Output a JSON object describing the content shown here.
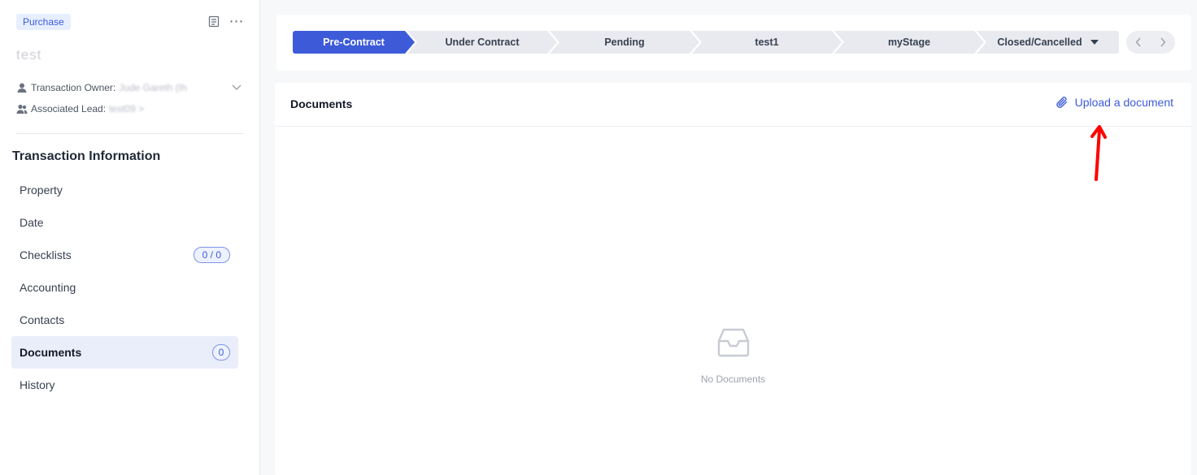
{
  "sidebar": {
    "type_badge": "Purchase",
    "transaction_name": "test",
    "owner_label": "Transaction Owner:",
    "owner_value": "Jude Gareth (Ih",
    "lead_label": "Associated Lead:",
    "lead_value": "test09 >",
    "section_title": "Transaction Information",
    "items": [
      {
        "label": "Property",
        "badge": ""
      },
      {
        "label": "Date",
        "badge": ""
      },
      {
        "label": "Checklists",
        "badge": "0 / 0"
      },
      {
        "label": "Accounting",
        "badge": ""
      },
      {
        "label": "Contacts",
        "badge": ""
      },
      {
        "label": "Documents",
        "badge": "0"
      },
      {
        "label": "History",
        "badge": ""
      }
    ],
    "active_item": "Documents"
  },
  "stages": {
    "items": [
      "Pre-Contract",
      "Under Contract",
      "Pending",
      "test1",
      "myStage",
      "Closed/Cancelled"
    ],
    "active": "Pre-Contract"
  },
  "documents": {
    "title": "Documents",
    "upload_label": "Upload a document",
    "empty_text": "No Documents"
  },
  "colors": {
    "accent": "#3d5bd9",
    "annotation_arrow": "#ff0000"
  }
}
